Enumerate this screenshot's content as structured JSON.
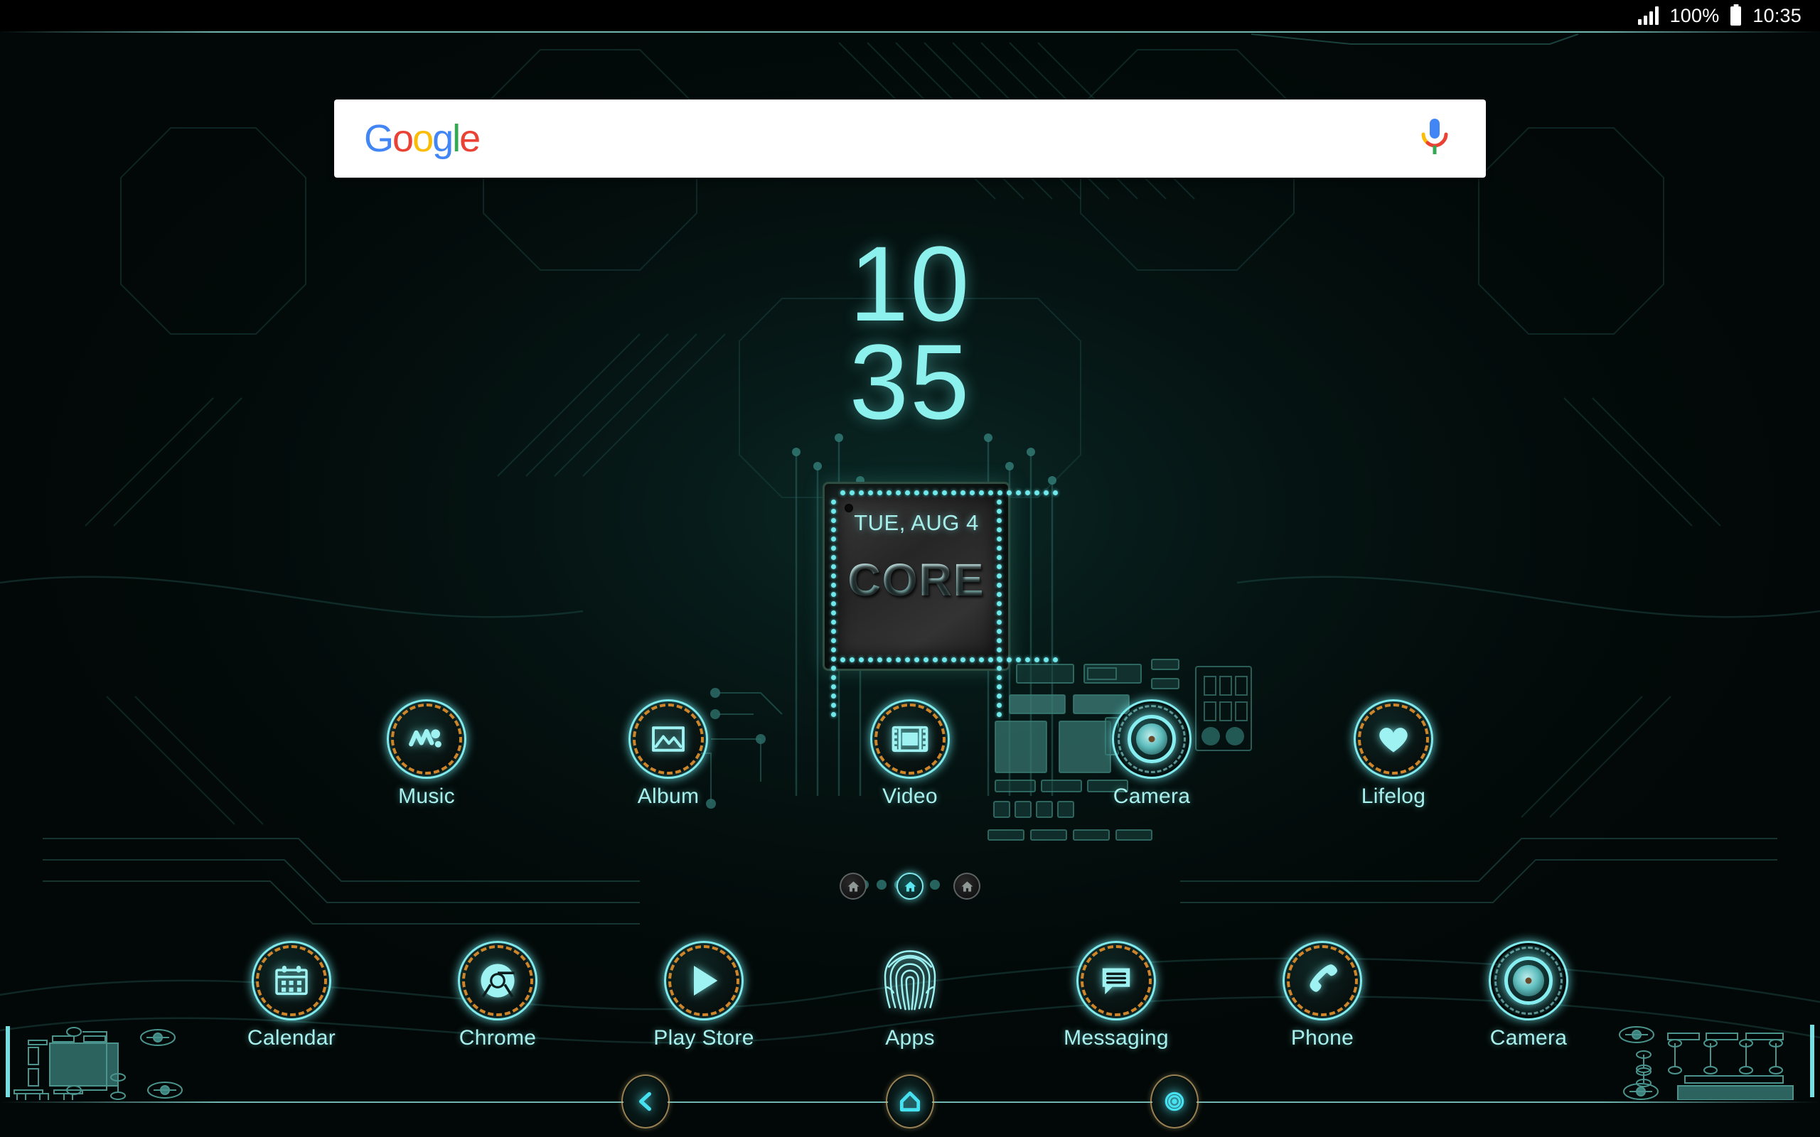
{
  "status_bar": {
    "signal_icon": "signal-bars-icon",
    "battery_percent": "100%",
    "battery_icon": "battery-full-icon",
    "time": "10:35"
  },
  "search": {
    "logo_letters": [
      "G",
      "o",
      "o",
      "g",
      "l",
      "e"
    ],
    "mic_icon": "microphone-icon",
    "placeholder": ""
  },
  "clock_widget": {
    "hours": "10",
    "minutes": "35",
    "color": "#8CF0EC"
  },
  "chip_widget": {
    "date": "TUE, AUG 4",
    "label": "CORE",
    "pin_color": "#6FE8EC"
  },
  "home_rows": [
    {
      "name": "row-one",
      "apps": [
        {
          "label": "Music",
          "icon": "walkman-music-icon",
          "style": "ring"
        },
        {
          "label": "Album",
          "icon": "photo-album-icon",
          "style": "ring"
        },
        {
          "label": "Video",
          "icon": "film-strip-icon",
          "style": "ring"
        },
        {
          "label": "Camera",
          "icon": "camera-lens-icon",
          "style": "lens"
        },
        {
          "label": "Lifelog",
          "icon": "heart-icon",
          "style": "ring"
        }
      ]
    },
    {
      "name": "row-two",
      "apps": [
        {
          "label": "Calendar",
          "icon": "calendar-icon",
          "style": "ring"
        },
        {
          "label": "Chrome",
          "icon": "chrome-icon",
          "style": "ring"
        },
        {
          "label": "Play Store",
          "icon": "play-triangle-icon",
          "style": "ring"
        },
        {
          "label": "Apps",
          "icon": "fingerprint-icon",
          "style": "noring"
        },
        {
          "label": "Messaging",
          "icon": "speech-bubble-icon",
          "style": "ring"
        },
        {
          "label": "Phone",
          "icon": "phone-handset-icon",
          "style": "ring"
        },
        {
          "label": "Camera",
          "icon": "camera-lens-icon",
          "style": "lens"
        }
      ]
    }
  ],
  "page_indicator": {
    "count": 3,
    "active_index": 1,
    "icon": "home-icon"
  },
  "nav_bar": {
    "buttons": [
      {
        "name": "back-button",
        "icon": "chevron-left-icon"
      },
      {
        "name": "home-button",
        "icon": "home-pentagon-icon"
      },
      {
        "name": "recents-button",
        "icon": "circle-recents-icon"
      }
    ]
  },
  "theme": {
    "accent_cyan": "#7FE9EC",
    "accent_amber": "#D98B2B",
    "background": "#020807",
    "label_color": "#A8F0ED"
  }
}
